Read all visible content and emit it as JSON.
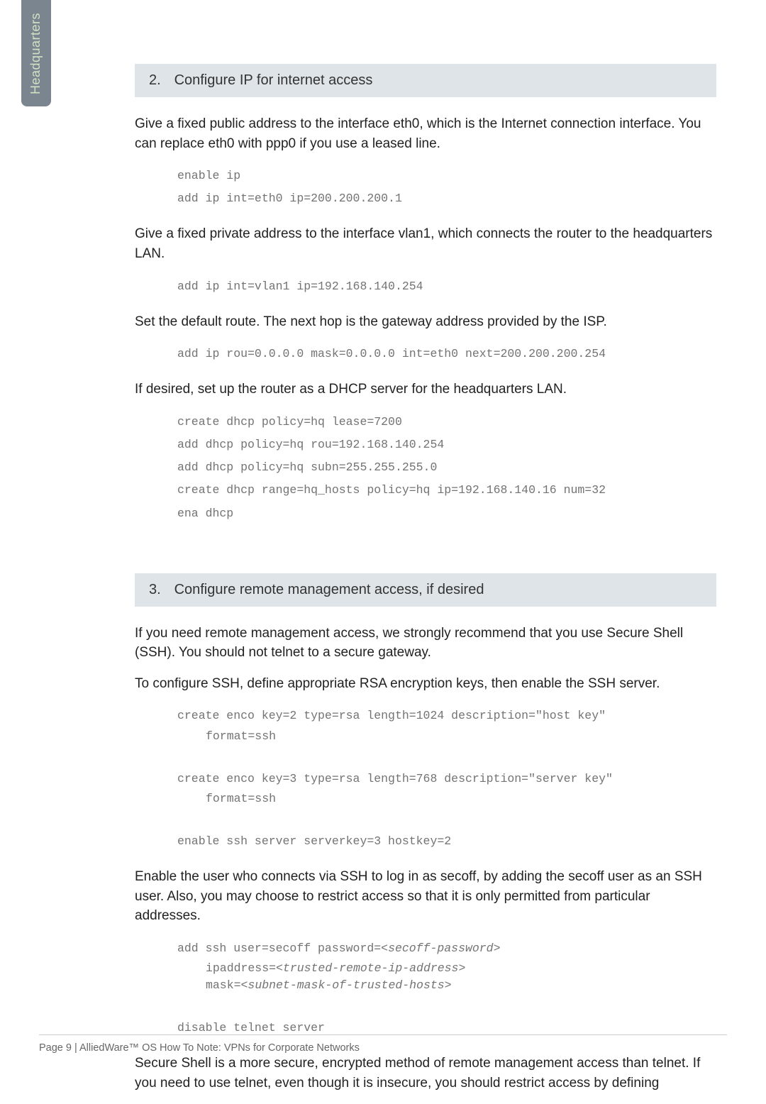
{
  "sidebar": {
    "label": "Headquarters"
  },
  "step2": {
    "number": "2.",
    "title": "Configure IP for internet access",
    "p1": "Give a fixed public address to the interface eth0, which is the Internet connection interface. You can replace eth0 with ppp0 if you use a leased line.",
    "code1": "enable ip\nadd ip int=eth0 ip=200.200.200.1",
    "p2": "Give a fixed private address to the interface vlan1, which connects the router to the headquarters LAN.",
    "code2": "add ip int=vlan1 ip=192.168.140.254",
    "p3": "Set the default route. The next hop is the gateway address provided by the ISP.",
    "code3": "add ip rou=0.0.0.0 mask=0.0.0.0 int=eth0 next=200.200.200.254",
    "p4": "If desired, set up the router as a DHCP server for the headquarters LAN.",
    "code4": "create dhcp policy=hq lease=7200\nadd dhcp policy=hq rou=192.168.140.254\nadd dhcp policy=hq subn=255.255.255.0\ncreate dhcp range=hq_hosts policy=hq ip=192.168.140.16 num=32\nena dhcp"
  },
  "step3": {
    "number": "3.",
    "title": "Configure remote management access, if desired",
    "p1": "If you need remote management access, we strongly recommend that you use Secure Shell (SSH). You should not telnet to a secure gateway.",
    "p2": "To configure SSH, define appropriate RSA encryption keys, then enable the SSH server.",
    "code1a": "create enco key=2 type=rsa length=1024 description=\"host key\"",
    "code1a_indent": "format=ssh",
    "code1b": "create enco key=3 type=rsa length=768 description=\"server key\"",
    "code1b_indent": "format=ssh",
    "code1c": "enable ssh server serverkey=3 hostkey=2",
    "p3": "Enable the user who connects via SSH to log in as secoff, by adding the secoff user as an SSH user. Also, you may choose to restrict access so that it is only permitted from particular addresses.",
    "code2_l1a": "add ssh user=secoff password=<",
    "code2_l1b": "secoff-password",
    "code2_l1c": ">",
    "code2_l2a": "ipaddress=<",
    "code2_l2b": "trusted-remote-ip-address",
    "code2_l2c": ">",
    "code2_l3a": "mask=<",
    "code2_l3b": "subnet-mask-of-trusted-hosts",
    "code2_l3c": ">",
    "code2_l4": "disable telnet server",
    "p4": "Secure Shell is a more secure, encrypted method of remote management access than telnet. If you need to use telnet, even though it is insecure, you should restrict access by defining"
  },
  "footer": "Page 9 | AlliedWare™ OS How To Note: VPNs for Corporate Networks"
}
